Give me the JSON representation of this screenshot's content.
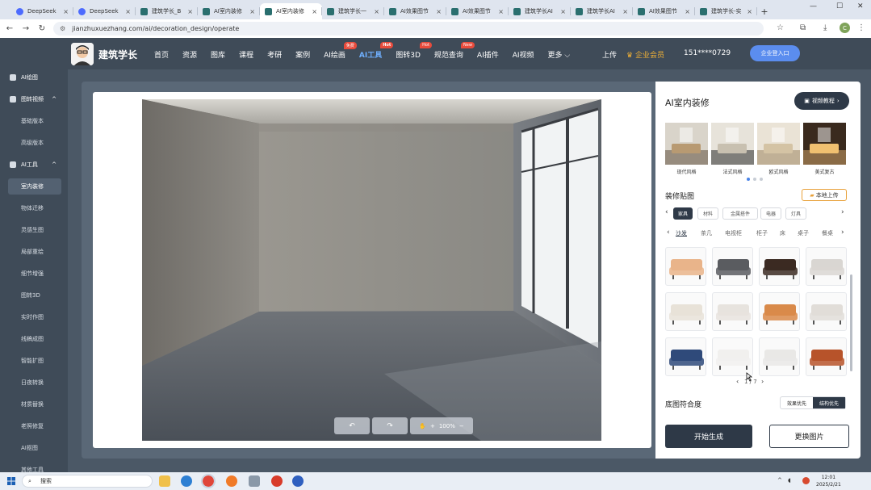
{
  "browser": {
    "tabs": [
      {
        "label": "DeepSeek",
        "active": false
      },
      {
        "label": "DeepSeek",
        "active": false
      },
      {
        "label": "建筑学长_B",
        "active": false
      },
      {
        "label": "AI室内装修",
        "active": false
      },
      {
        "label": "AI室内装修",
        "active": true
      },
      {
        "label": "建筑学长一",
        "active": false
      },
      {
        "label": "AI效果图节",
        "active": false
      },
      {
        "label": "AI效果图节",
        "active": false
      },
      {
        "label": "建筑学长AI",
        "active": false
      },
      {
        "label": "建筑学长AI",
        "active": false
      },
      {
        "label": "AI效果图节",
        "active": false
      },
      {
        "label": "建筑学长-实",
        "active": false
      }
    ],
    "url": "jianzhuxuezhang.com/ai/decoration_design/operate",
    "profile_initial": "C"
  },
  "header": {
    "logo_text": "建筑学长",
    "nav": [
      {
        "label": "首页"
      },
      {
        "label": "资源"
      },
      {
        "label": "图库"
      },
      {
        "label": "课程"
      },
      {
        "label": "考研"
      },
      {
        "label": "案例"
      },
      {
        "label": "AI绘画",
        "badge": "免费"
      },
      {
        "label": "AI工具",
        "badge": "Hot",
        "active": true
      },
      {
        "label": "图转3D",
        "badge": "Hot"
      },
      {
        "label": "规范查询",
        "badge": "New"
      },
      {
        "label": "AI插件"
      },
      {
        "label": "AI视频"
      },
      {
        "label": "更多 ⌵"
      }
    ],
    "upload": "上传",
    "vip": "企业会员",
    "phone": "151****0729",
    "enterprise_button": "企业登入口"
  },
  "sidebar": {
    "items": [
      {
        "label": "AI绘图",
        "kind": "group"
      },
      {
        "label": "图转视频",
        "kind": "group",
        "caret": "^"
      },
      {
        "label": "基础版本",
        "kind": "sub"
      },
      {
        "label": "高级版本",
        "kind": "sub"
      },
      {
        "label": "AI工具",
        "kind": "group",
        "caret": "^"
      },
      {
        "label": "室内装修",
        "kind": "sel"
      },
      {
        "label": "物体迁移",
        "kind": "sub"
      },
      {
        "label": "灵感生图",
        "kind": "sub"
      },
      {
        "label": "局部重绘",
        "kind": "sub"
      },
      {
        "label": "细节增强",
        "kind": "sub"
      },
      {
        "label": "图转3D",
        "kind": "sub"
      },
      {
        "label": "实时作图",
        "kind": "sub"
      },
      {
        "label": "线稿成图",
        "kind": "sub"
      },
      {
        "label": "智能扩图",
        "kind": "sub"
      },
      {
        "label": "日夜转换",
        "kind": "sub"
      },
      {
        "label": "材质替换",
        "kind": "sub"
      },
      {
        "label": "老照修复",
        "kind": "sub"
      },
      {
        "label": "AI抠图",
        "kind": "sub"
      },
      {
        "label": "其他工具",
        "kind": "sub"
      }
    ]
  },
  "canvas": {
    "toolbar": {
      "undo": "↶",
      "redo": "↷",
      "hand": "✋",
      "zoom_in": "+",
      "zoom": "100%",
      "zoom_out": "−"
    }
  },
  "panel": {
    "title": "AI室内装修",
    "tutorial_button": "视频教程",
    "styles": [
      {
        "label": "现代风格"
      },
      {
        "label": "法式风格"
      },
      {
        "label": "欧式风格"
      },
      {
        "label": "美式复古"
      }
    ],
    "section_title": "装修贴图",
    "local_upload": "本地上传",
    "categories": [
      {
        "label": "家具",
        "active": true
      },
      {
        "label": "材料"
      },
      {
        "label": "金属搭件"
      },
      {
        "label": "电器"
      },
      {
        "label": "灯具"
      }
    ],
    "subcategories": [
      {
        "label": "沙发",
        "active": true
      },
      {
        "label": "茶几"
      },
      {
        "label": "电视柜"
      },
      {
        "label": "柜子"
      },
      {
        "label": "床"
      },
      {
        "label": "桌子"
      },
      {
        "label": "餐桌"
      }
    ],
    "pager": "1 / 7",
    "fit_title": "底图符合度",
    "fit_options": [
      {
        "label": "效果优先",
        "active": false
      },
      {
        "label": "结构优先",
        "active": true
      }
    ],
    "generate_button": "开始生成",
    "replace_button": "更换图片"
  },
  "taskbar": {
    "search_placeholder": "搜索",
    "time": "12:01",
    "date": "2025/2/21"
  },
  "colors": {
    "dark_header": "#3f4b58",
    "accent_dark": "#2e3947",
    "active_nav": "#6fb0ff",
    "badge_red": "#e84b3c",
    "vip_gold": "#f2b236"
  }
}
